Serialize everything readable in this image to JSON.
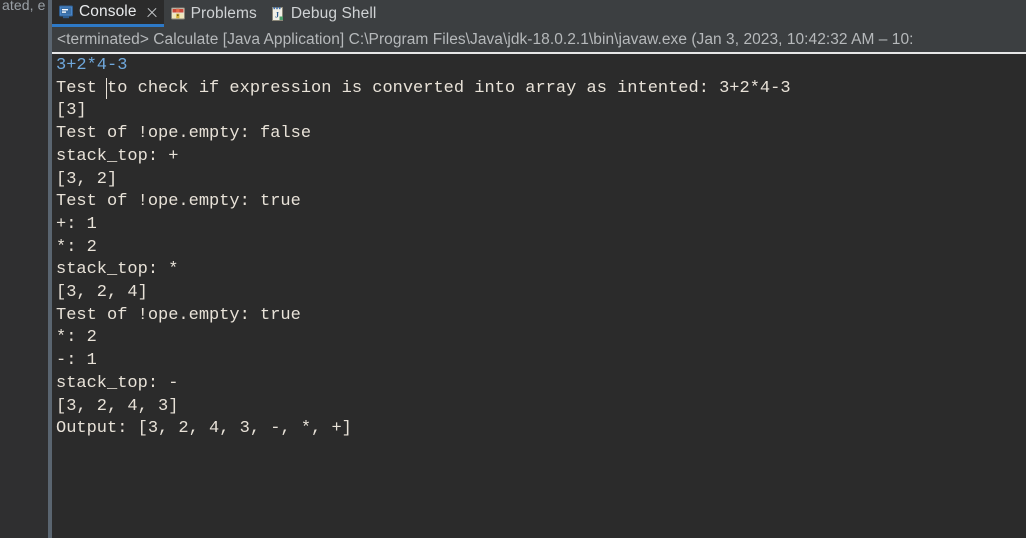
{
  "editor_strip": {
    "partial_text": "ated, e"
  },
  "tabs": [
    {
      "id": "console",
      "label": "Console",
      "icon": "console-monitor-icon",
      "active": true,
      "closable": true
    },
    {
      "id": "problems",
      "label": "Problems",
      "icon": "problems-warning-icon",
      "active": false,
      "closable": false
    },
    {
      "id": "debug-shell",
      "label": "Debug Shell",
      "icon": "debug-shell-icon",
      "active": false,
      "closable": false
    }
  ],
  "process_header": {
    "text": "<terminated> Calculate [Java Application] C:\\Program Files\\Java\\jdk-18.0.2.1\\bin\\javaw.exe  (Jan 3, 2023, 10:42:32 AM – 10:"
  },
  "console_output": {
    "lines": [
      {
        "text": "3+2*4-3",
        "style": "input-echo"
      },
      {
        "text": "Test to check if expression is converted into array as intented: 3+2*4-3",
        "style": "stdout"
      },
      {
        "text": "[3]",
        "style": "stdout"
      },
      {
        "text": "Test of !ope.empty: false",
        "style": "stdout"
      },
      {
        "text": "stack_top: +",
        "style": "stdout"
      },
      {
        "text": "[3, 2]",
        "style": "stdout"
      },
      {
        "text": "Test of !ope.empty: true",
        "style": "stdout"
      },
      {
        "text": "+: 1",
        "style": "stdout"
      },
      {
        "text": "*: 2",
        "style": "stdout"
      },
      {
        "text": "stack_top: *",
        "style": "stdout"
      },
      {
        "text": "[3, 2, 4]",
        "style": "stdout"
      },
      {
        "text": "Test of !ope.empty: true",
        "style": "stdout"
      },
      {
        "text": "*: 2",
        "style": "stdout"
      },
      {
        "text": "-: 1",
        "style": "stdout"
      },
      {
        "text": "stack_top: -",
        "style": "stdout"
      },
      {
        "text": "[3, 2, 4, 3]",
        "style": "stdout"
      },
      {
        "text": "Output: [3, 2, 4, 3, -, *, +]",
        "style": "stdout"
      }
    ]
  },
  "colors": {
    "panel_background": "#3c3f41",
    "console_background": "#2b2b2b",
    "active_tab_underline": "#2d79c7",
    "stdout_text": "#e8e2d8",
    "input_echo_text": "#6fa8dc",
    "divider": "#5a6570",
    "header_rule": "#e7e7e7"
  }
}
